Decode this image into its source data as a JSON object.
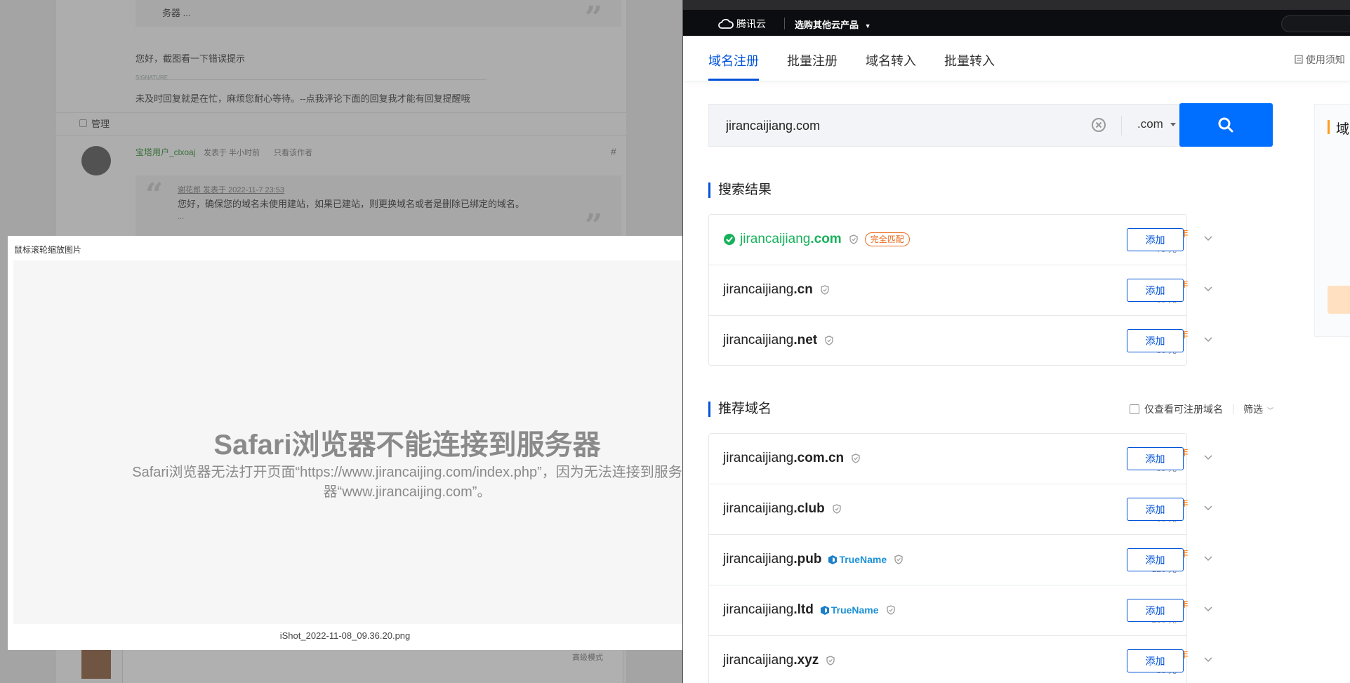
{
  "forum": {
    "quote1_tail": "务器 ...",
    "reply1": "您好，截图看一下错误提示",
    "signature_label": "SIGNATURE",
    "signature": "未及时回复就是在忙，麻烦您耐心等待。--点我评论下面的回复我才能有回复提醒哦",
    "manage_label": "管理",
    "post_user": "宝塔用户_clxoaj",
    "post_time": "发表于 半小时前",
    "only_author": "只看该作者",
    "quote2_author": "谢花郎 发表于 2022-11-7 23:53",
    "quote2_text": "您好，确保您的域名未使用建站，如果已建站，则更换域名或者是删除已绑定的域名。",
    "quote2_ellipsis": "...",
    "editor_label": "高级模式"
  },
  "lightbox": {
    "title": "鼠标滚轮缩放图片",
    "error_title": "Safari浏览器不能连接到服务器",
    "error_body": "Safari浏览器无法打开页面“https://www.jirancaijing.com/index.php”，因为无法连接到服务器“www.jirancaijing.com”。",
    "caption": "iShot_2022-11-08_09.36.20.png"
  },
  "header": {
    "brand": "腾讯云",
    "product_menu": "选购其他云产品"
  },
  "tabs": [
    {
      "label": "域名注册"
    },
    {
      "label": "批量注册"
    },
    {
      "label": "域名转入"
    },
    {
      "label": "批量转入"
    }
  ],
  "help_label": "使用须知",
  "search": {
    "value": "jirancaijiang.com",
    "tld": ".com"
  },
  "results_title": "搜索结果",
  "reco_title": "推荐域名",
  "reco_filter_label": "仅查看可注册域名",
  "reco_sort_label": "筛选",
  "add_label": "添加",
  "price_unit": "元/首年",
  "match_badge": "完全匹配",
  "truename_label": "TrueName",
  "results": [
    {
      "name": "jirancaijiang",
      "tld": ".com",
      "price": "68",
      "old": "75 元",
      "exact": true
    },
    {
      "name": "jirancaijiang",
      "tld": ".cn",
      "price": "36",
      "old": "39 元"
    },
    {
      "name": "jirancaijiang",
      "tld": ".net",
      "price": "73",
      "old": "80 元"
    }
  ],
  "recommend": [
    {
      "name": "jirancaijiang",
      "tld": ".com.cn",
      "price": "36",
      "old": "39 元"
    },
    {
      "name": "jirancaijiang",
      "tld": ".club",
      "price": "10",
      "old": "80 元"
    },
    {
      "name": "jirancaijiang",
      "tld": ".pub",
      "price": "10",
      "old": "120 元",
      "truename": true
    },
    {
      "name": "jirancaijiang",
      "tld": ".ltd",
      "price": "10",
      "old": "280 元",
      "truename": true
    },
    {
      "name": "jirancaijiang",
      "tld": ".xyz",
      "price": "13",
      "old": "80 元"
    }
  ],
  "side_label": "域",
  "colors": {
    "brand_blue": "#0052d9",
    "search_blue": "#006eff",
    "price_orange": "#ff7200",
    "match_green": "#18b15b"
  }
}
